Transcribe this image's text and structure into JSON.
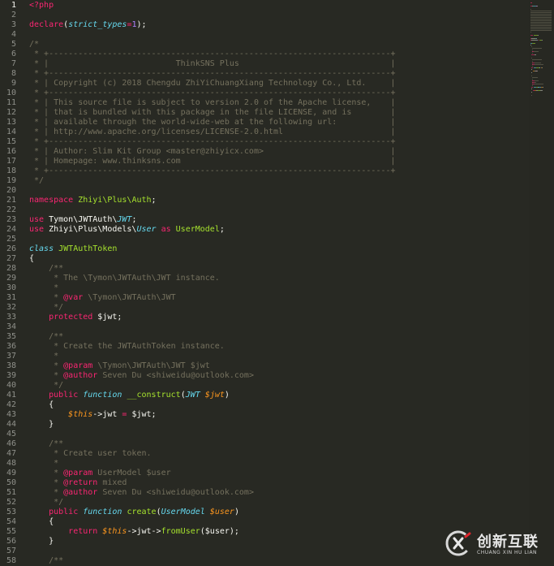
{
  "editor": {
    "colors": {
      "background": "#282923",
      "keyword": "#f92672",
      "storage": "#66d9ef",
      "function": "#a6e22e",
      "number": "#ae81ff",
      "variable": "#fd971f",
      "comment": "#75715e",
      "text": "#f8f8f2"
    },
    "lines": [
      {
        "n": "1",
        "t": [
          {
            "c": "tag",
            "v": "<?php"
          }
        ]
      },
      {
        "n": "2",
        "t": []
      },
      {
        "n": "3",
        "t": [
          {
            "c": "kw",
            "v": "declare"
          },
          {
            "c": "",
            "v": "("
          },
          {
            "c": "st",
            "v": "strict_types"
          },
          {
            "c": "kw",
            "v": "="
          },
          {
            "c": "num",
            "v": "1"
          },
          {
            "c": "",
            "v": ");"
          }
        ]
      },
      {
        "n": "4",
        "t": []
      },
      {
        "n": "5",
        "t": [
          {
            "c": "cm",
            "v": "/*"
          }
        ]
      },
      {
        "n": "6",
        "t": [
          {
            "c": "cm",
            "v": " * +----------------------------------------------------------------------+"
          }
        ]
      },
      {
        "n": "7",
        "t": [
          {
            "c": "cm",
            "v": " * |                          ThinkSNS Plus                               |"
          }
        ]
      },
      {
        "n": "8",
        "t": [
          {
            "c": "cm",
            "v": " * +----------------------------------------------------------------------+"
          }
        ]
      },
      {
        "n": "9",
        "t": [
          {
            "c": "cm",
            "v": " * | Copyright (c) 2018 Chengdu ZhiYiChuangXiang Technology Co., Ltd.     |"
          }
        ]
      },
      {
        "n": "10",
        "t": [
          {
            "c": "cm",
            "v": " * +----------------------------------------------------------------------+"
          }
        ]
      },
      {
        "n": "11",
        "t": [
          {
            "c": "cm",
            "v": " * | This source file is subject to version 2.0 of the Apache license,    |"
          }
        ]
      },
      {
        "n": "12",
        "t": [
          {
            "c": "cm",
            "v": " * | that is bundled with this package in the file LICENSE, and is        |"
          }
        ]
      },
      {
        "n": "13",
        "t": [
          {
            "c": "cm",
            "v": " * | available through the world-wide-web at the following url:           |"
          }
        ]
      },
      {
        "n": "14",
        "t": [
          {
            "c": "cm",
            "v": " * | http://www.apache.org/licenses/LICENSE-2.0.html                      |"
          }
        ]
      },
      {
        "n": "15",
        "t": [
          {
            "c": "cm",
            "v": " * +----------------------------------------------------------------------+"
          }
        ]
      },
      {
        "n": "16",
        "t": [
          {
            "c": "cm",
            "v": " * | Author: Slim Kit Group <master@zhiyicx.com>                          |"
          }
        ]
      },
      {
        "n": "17",
        "t": [
          {
            "c": "cm",
            "v": " * | Homepage: www.thinksns.com                                           |"
          }
        ]
      },
      {
        "n": "18",
        "t": [
          {
            "c": "cm",
            "v": " * +----------------------------------------------------------------------+"
          }
        ]
      },
      {
        "n": "19",
        "t": [
          {
            "c": "cm",
            "v": " */"
          }
        ]
      },
      {
        "n": "20",
        "t": []
      },
      {
        "n": "21",
        "t": [
          {
            "c": "kw",
            "v": "namespace"
          },
          {
            "c": "",
            "v": " "
          },
          {
            "c": "fn",
            "v": "Zhiyi\\Plus\\Auth"
          },
          {
            "c": "",
            "v": ";"
          }
        ]
      },
      {
        "n": "22",
        "t": []
      },
      {
        "n": "23",
        "t": [
          {
            "c": "kw",
            "v": "use"
          },
          {
            "c": "",
            "v": " Tymon\\JWTAuth\\"
          },
          {
            "c": "st",
            "v": "JWT"
          },
          {
            "c": "",
            "v": ";"
          }
        ]
      },
      {
        "n": "24",
        "t": [
          {
            "c": "kw",
            "v": "use"
          },
          {
            "c": "",
            "v": " Zhiyi\\Plus\\Models\\"
          },
          {
            "c": "st",
            "v": "User"
          },
          {
            "c": "",
            "v": " "
          },
          {
            "c": "kw",
            "v": "as"
          },
          {
            "c": "",
            "v": " "
          },
          {
            "c": "fn",
            "v": "UserModel"
          },
          {
            "c": "",
            "v": ";"
          }
        ]
      },
      {
        "n": "25",
        "t": []
      },
      {
        "n": "26",
        "t": [
          {
            "c": "st",
            "v": "class"
          },
          {
            "c": "",
            "v": " "
          },
          {
            "c": "fn",
            "v": "JWTAuthToken"
          }
        ]
      },
      {
        "n": "27",
        "t": [
          {
            "c": "",
            "v": "{"
          }
        ]
      },
      {
        "n": "28",
        "t": [
          {
            "c": "cm",
            "v": "    /**"
          }
        ]
      },
      {
        "n": "29",
        "t": [
          {
            "c": "cm",
            "v": "     * The \\Tymon\\JWTAuth\\JWT instance."
          }
        ]
      },
      {
        "n": "30",
        "t": [
          {
            "c": "cm",
            "v": "     *"
          }
        ]
      },
      {
        "n": "31",
        "t": [
          {
            "c": "cm",
            "v": "     * "
          },
          {
            "c": "kw",
            "v": "@var"
          },
          {
            "c": "cm",
            "v": " \\Tymon\\JWTAuth\\JWT"
          }
        ]
      },
      {
        "n": "32",
        "t": [
          {
            "c": "cm",
            "v": "     */"
          }
        ]
      },
      {
        "n": "33",
        "t": [
          {
            "c": "",
            "v": "    "
          },
          {
            "c": "kw",
            "v": "protected"
          },
          {
            "c": "",
            "v": " $jwt;"
          }
        ]
      },
      {
        "n": "34",
        "t": []
      },
      {
        "n": "35",
        "t": [
          {
            "c": "cm",
            "v": "    /**"
          }
        ]
      },
      {
        "n": "36",
        "t": [
          {
            "c": "cm",
            "v": "     * Create the JWTAuthToken instance."
          }
        ]
      },
      {
        "n": "37",
        "t": [
          {
            "c": "cm",
            "v": "     *"
          }
        ]
      },
      {
        "n": "38",
        "t": [
          {
            "c": "cm",
            "v": "     * "
          },
          {
            "c": "kw",
            "v": "@param"
          },
          {
            "c": "cm",
            "v": " \\Tymon\\JWTAuth\\JWT $jwt"
          }
        ]
      },
      {
        "n": "39",
        "t": [
          {
            "c": "cm",
            "v": "     * "
          },
          {
            "c": "kw",
            "v": "@author"
          },
          {
            "c": "cm",
            "v": " Seven Du <shiweidu@outlook.com>"
          }
        ]
      },
      {
        "n": "40",
        "t": [
          {
            "c": "cm",
            "v": "     */"
          }
        ]
      },
      {
        "n": "41",
        "t": [
          {
            "c": "",
            "v": "    "
          },
          {
            "c": "kw",
            "v": "public"
          },
          {
            "c": "",
            "v": " "
          },
          {
            "c": "st",
            "v": "function"
          },
          {
            "c": "",
            "v": " "
          },
          {
            "c": "fn",
            "v": "__construct"
          },
          {
            "c": "",
            "v": "("
          },
          {
            "c": "st",
            "v": "JWT"
          },
          {
            "c": "",
            "v": " "
          },
          {
            "c": "var",
            "v": "$jwt"
          },
          {
            "c": "",
            "v": ")"
          }
        ]
      },
      {
        "n": "42",
        "t": [
          {
            "c": "",
            "v": "    {"
          }
        ]
      },
      {
        "n": "43",
        "t": [
          {
            "c": "",
            "v": "        "
          },
          {
            "c": "this",
            "v": "$this"
          },
          {
            "c": "",
            "v": "->jwt "
          },
          {
            "c": "kw",
            "v": "="
          },
          {
            "c": "",
            "v": " $jwt;"
          }
        ]
      },
      {
        "n": "44",
        "t": [
          {
            "c": "",
            "v": "    }"
          }
        ]
      },
      {
        "n": "45",
        "t": []
      },
      {
        "n": "46",
        "t": [
          {
            "c": "cm",
            "v": "    /**"
          }
        ]
      },
      {
        "n": "47",
        "t": [
          {
            "c": "cm",
            "v": "     * Create user token."
          }
        ]
      },
      {
        "n": "48",
        "t": [
          {
            "c": "cm",
            "v": "     *"
          }
        ]
      },
      {
        "n": "49",
        "t": [
          {
            "c": "cm",
            "v": "     * "
          },
          {
            "c": "kw",
            "v": "@param"
          },
          {
            "c": "cm",
            "v": " UserModel $user"
          }
        ]
      },
      {
        "n": "50",
        "t": [
          {
            "c": "cm",
            "v": "     * "
          },
          {
            "c": "kw",
            "v": "@return"
          },
          {
            "c": "cm",
            "v": " mixed"
          }
        ]
      },
      {
        "n": "51",
        "t": [
          {
            "c": "cm",
            "v": "     * "
          },
          {
            "c": "kw",
            "v": "@author"
          },
          {
            "c": "cm",
            "v": " Seven Du <shiweidu@outlook.com>"
          }
        ]
      },
      {
        "n": "52",
        "t": [
          {
            "c": "cm",
            "v": "     */"
          }
        ]
      },
      {
        "n": "53",
        "t": [
          {
            "c": "",
            "v": "    "
          },
          {
            "c": "kw",
            "v": "public"
          },
          {
            "c": "",
            "v": " "
          },
          {
            "c": "st",
            "v": "function"
          },
          {
            "c": "",
            "v": " "
          },
          {
            "c": "fn",
            "v": "create"
          },
          {
            "c": "",
            "v": "("
          },
          {
            "c": "st",
            "v": "UserModel"
          },
          {
            "c": "",
            "v": " "
          },
          {
            "c": "var",
            "v": "$user"
          },
          {
            "c": "",
            "v": ")"
          }
        ]
      },
      {
        "n": "54",
        "t": [
          {
            "c": "",
            "v": "    {"
          }
        ]
      },
      {
        "n": "55",
        "t": [
          {
            "c": "",
            "v": "        "
          },
          {
            "c": "kw",
            "v": "return"
          },
          {
            "c": "",
            "v": " "
          },
          {
            "c": "this",
            "v": "$this"
          },
          {
            "c": "",
            "v": "->jwt->"
          },
          {
            "c": "fn",
            "v": "fromUser"
          },
          {
            "c": "",
            "v": "($user);"
          }
        ]
      },
      {
        "n": "56",
        "t": [
          {
            "c": "",
            "v": "    }"
          }
        ]
      },
      {
        "n": "57",
        "t": []
      },
      {
        "n": "58",
        "t": [
          {
            "c": "cm",
            "v": "    /**"
          }
        ]
      }
    ]
  },
  "watermark": {
    "title": "创新互联",
    "subtitle": "CHUANG XIN HU LIAN"
  }
}
